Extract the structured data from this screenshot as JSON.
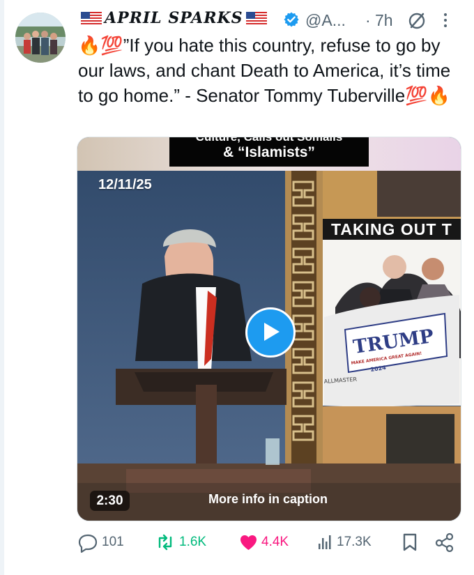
{
  "tweet": {
    "display_name": "APRIL SPARKS",
    "handle": "@A...",
    "separator": "·",
    "time": "7h",
    "text": "🔥💯”If you hate this country, refuse to go by our laws, and chant Death to America, it’s time to go home.” - Senator Tommy Tuberville💯🔥",
    "icons": {
      "flag": "us-flag-icon",
      "verified": "verified-badge-icon",
      "grok": "grok-icon",
      "more": "more-icon"
    }
  },
  "media": {
    "caption_line1": "Culture, Calls out Somalis",
    "caption_line2": "& “Islamists”",
    "date": "12/11/25",
    "inset_heading": "TAKING OUT T",
    "sign_title": "TRUMP",
    "sign_subtitle": "MAKE AMERICA GREAT AGAIN!",
    "sign_year": "2024",
    "sign_maker": "ALLMASTER",
    "duration": "2:30",
    "more_info": "More info in caption",
    "icons": {
      "play": "play-icon"
    }
  },
  "actions": {
    "reply_count": "101",
    "repost_count": "1.6K",
    "like_count": "4.4K",
    "views_count": "17.3K",
    "icons": {
      "reply": "reply-icon",
      "repost": "repost-icon",
      "like": "heart-icon",
      "views": "views-icon",
      "bookmark": "bookmark-icon",
      "share": "share-icon"
    }
  },
  "colors": {
    "accent": "#1d9bf0",
    "repost_green": "#00ba7c",
    "like_pink": "#f91880",
    "secondary_text": "#536471"
  }
}
